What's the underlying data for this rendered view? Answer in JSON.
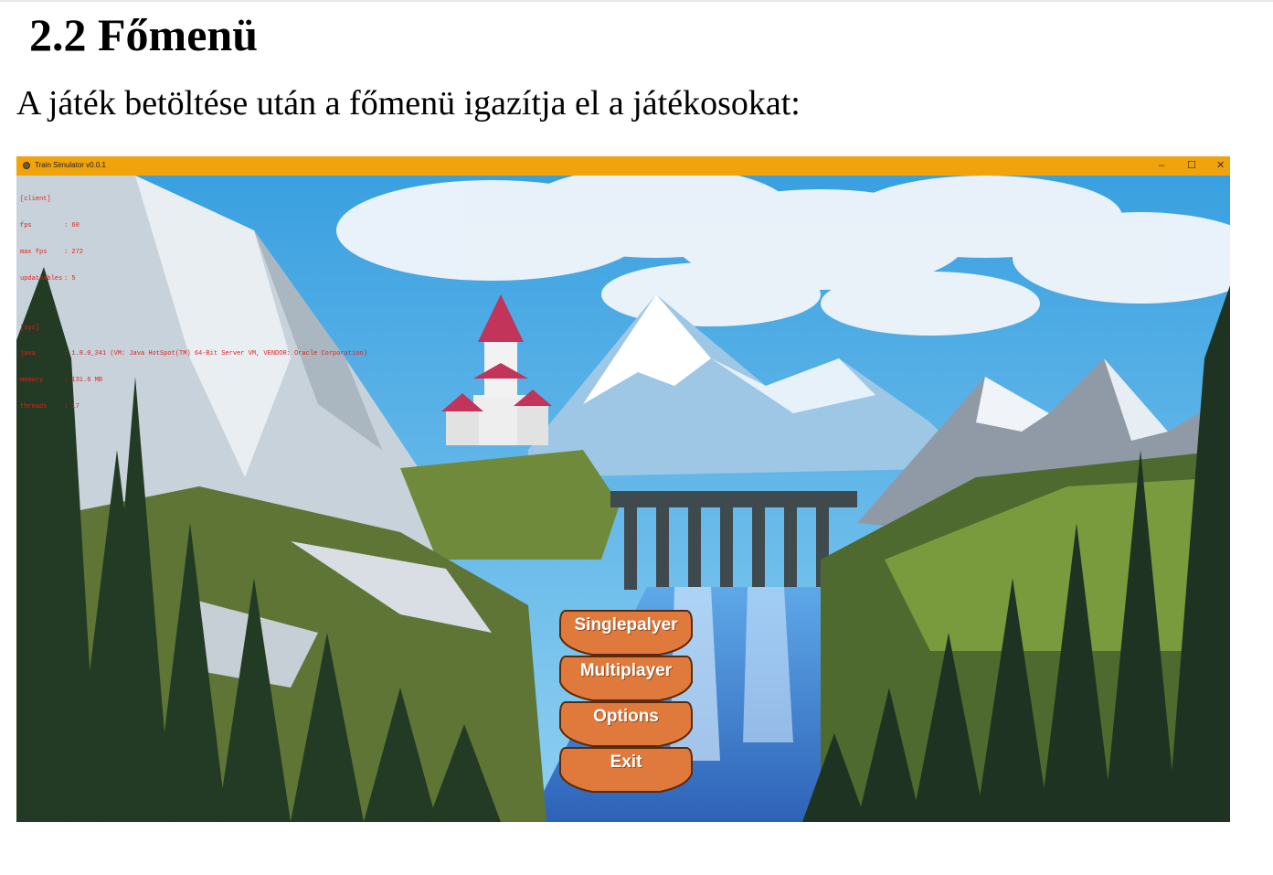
{
  "document": {
    "heading": "2.2 Főmenü",
    "intro": "A játék betöltése után a főmenü igazítja el a játékosokat:"
  },
  "window": {
    "title": "Train Simulator v0.0.1",
    "controls": {
      "minimize": "–",
      "maximize": "☐",
      "close": "✕"
    },
    "accent_color": "#f0a30a"
  },
  "debug_overlay": {
    "client": {
      "header": "[client]",
      "lines": [
        {
          "label": "fps",
          "value": ": 60"
        },
        {
          "label": "max fps",
          "value": ": 272"
        },
        {
          "label": "updateables",
          "value": ": 5"
        }
      ]
    },
    "sys": {
      "header": "[sys]",
      "lines": [
        {
          "label": "java",
          "value": ": 1.8.0_341 (VM: Java HotSpot(TM) 64-Bit Server VM, VENDOR: Oracle Corporation)"
        },
        {
          "label": "memory",
          "value": ": 131.6 MB"
        },
        {
          "label": "threads",
          "value": ": 17"
        }
      ]
    },
    "color": "#e0201c"
  },
  "main_menu": {
    "buttons": [
      {
        "id": "singleplayer",
        "label": "Singlepalyer"
      },
      {
        "id": "multiplayer",
        "label": "Multiplayer"
      },
      {
        "id": "options",
        "label": "Options"
      },
      {
        "id": "exit",
        "label": "Exit"
      }
    ],
    "button_color": "#e07a3c"
  }
}
